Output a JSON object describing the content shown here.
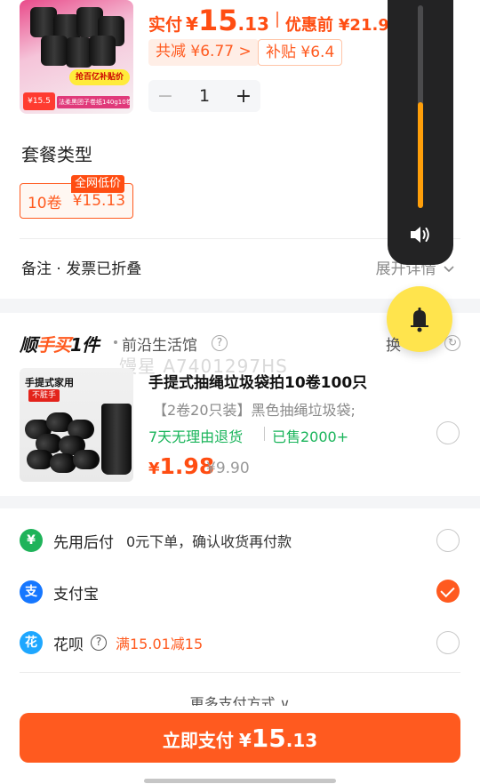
{
  "top_product": {
    "thumb_banner": "抢百亿补贴价",
    "thumb_price": "¥15.5",
    "thumb_caption": "法柔黑团子卷纸140g10卷",
    "price_label": "实付",
    "price_currency": "¥",
    "price_int": "15",
    "price_dec": ".13",
    "orig_label": "优惠前",
    "orig_value": "¥21.9",
    "discount_chip": "共减 ¥6.77 >",
    "subsidy_chip": "补贴 ¥6.4",
    "quantity": "1",
    "minus": "−",
    "plus": "+"
  },
  "volume": {
    "level_percent": 52,
    "accent": "#ff9f0a"
  },
  "package": {
    "title": "套餐类型",
    "option_name": "10卷",
    "option_price": "¥15.13",
    "badge": "全网低价"
  },
  "note": {
    "label": "备注 · 发票已折叠",
    "expand": "展开详情"
  },
  "shunshoumai": {
    "logo_a": "顺",
    "logo_b": "手买",
    "logo_c": "1件",
    "shop": "前沿生活馆",
    "right_text": "换",
    "watermark": "馒星 A7401297HS",
    "product_tag1": "手提式家用",
    "product_tag2": "不脏手",
    "title": "手提式抽绳垃圾袋拍10卷100只",
    "subtitle": "【2卷20只装】黑色抽绳垃圾袋;",
    "return_policy": "7天无理由退货",
    "sold": "已售2000+",
    "price_currency": "¥",
    "price": "1.98",
    "orig_price": "¥9.90"
  },
  "payment": {
    "methods": [
      {
        "label": "先用后付",
        "extra": "0元下单，确认收货再付款",
        "icon": "leaf-icon",
        "icon_glyph": "¥",
        "color": "#1fb35a",
        "selected": false
      },
      {
        "label": "支付宝",
        "extra": "",
        "icon": "alipay-icon",
        "icon_glyph": "支",
        "color": "#1677ff",
        "selected": true
      },
      {
        "label": "花呗",
        "extra": "",
        "promo": "满15.01减15",
        "icon": "huabei-icon",
        "icon_glyph": "花",
        "color": "#1ea7ff",
        "selected": false
      }
    ],
    "more": "更多支付方式 ∨"
  },
  "pay_button": {
    "label": "立即支付",
    "currency": "¥",
    "int": "15",
    "dec": ".13"
  },
  "colors": {
    "accent": "#ff5a1f",
    "green": "#19b45a",
    "panel": "#232324",
    "bubble": "#ffe44d"
  }
}
